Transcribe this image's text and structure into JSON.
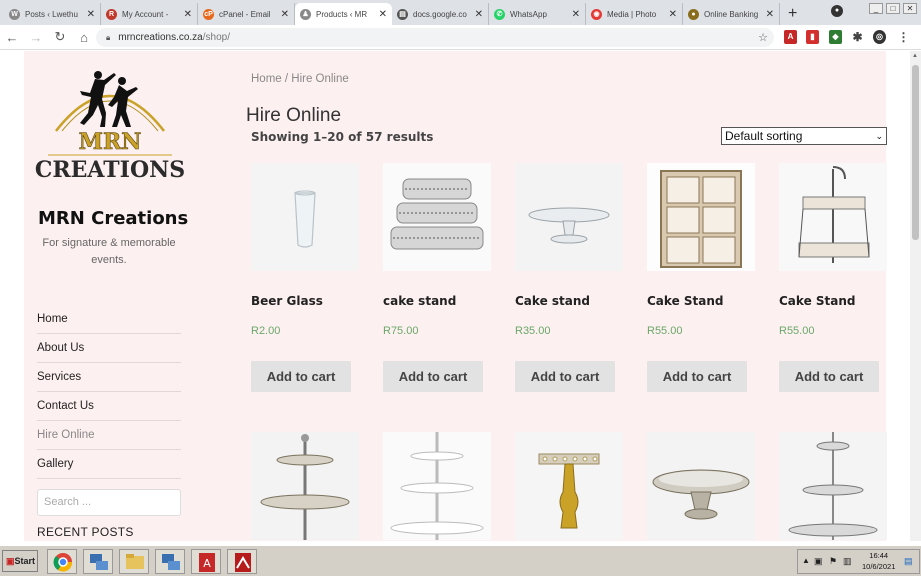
{
  "browser": {
    "tabs": [
      {
        "label": "Posts ‹ Lwethu",
        "icon_color": "#888888",
        "icon_letter": "W",
        "active": false
      },
      {
        "label": "My Account -",
        "icon_color": "#c0392b",
        "icon_letter": "R",
        "active": false
      },
      {
        "label": "cPanel - Email",
        "icon_color": "#e8691d",
        "icon_letter": "cP",
        "active": false
      },
      {
        "label": "Products ‹ MR",
        "icon_color": "#888888",
        "icon_letter": "♟",
        "active": true
      },
      {
        "label": "docs.google.co",
        "icon_color": "#555555",
        "icon_letter": "▤",
        "active": false
      },
      {
        "label": "WhatsApp",
        "icon_color": "#25d366",
        "icon_letter": "✆",
        "active": false
      },
      {
        "label": "Media | Photo",
        "icon_color": "#e53935",
        "icon_letter": "◉",
        "active": false
      },
      {
        "label": "Online Banking",
        "icon_color": "#8a6d1c",
        "icon_letter": "●",
        "active": false
      }
    ],
    "url_domain": "mrncreations.co.za",
    "url_path": "/shop/"
  },
  "site": {
    "logo_text_top": "MRN",
    "logo_text_bottom": "CREATIONS",
    "title": "MRN Creations",
    "tagline": "For signature & memorable events.",
    "menu": [
      "Home",
      "About Us",
      "Services",
      "Contact Us",
      "Hire Online",
      "Gallery"
    ],
    "current_menu": "Hire Online",
    "search_placeholder": "Search ...",
    "recent_posts_heading": "RECENT POSTS"
  },
  "shop": {
    "breadcrumb": "Home / Hire Online",
    "title": "Hire Online",
    "result_count": "Showing 1–20 of 57 results",
    "sorting": "Default sorting",
    "add_to_cart_label": "Add to cart",
    "products": [
      {
        "name": "Beer Glass",
        "price": "R2.00",
        "image": "beer-glass"
      },
      {
        "name": "cake stand",
        "price": "R75.00",
        "image": "mirror-cake-stands"
      },
      {
        "name": "Cake stand",
        "price": "R35.00",
        "image": "glass-cake-stand"
      },
      {
        "name": "Cake Stand",
        "price": "R55.00",
        "image": "wooden-cube-shelf"
      },
      {
        "name": "Cake Stand",
        "price": "R55.00",
        "image": "two-tier-wood-stand"
      }
    ],
    "second_row_images": [
      "ornate-silver-tier-stand",
      "white-tier-stand",
      "gold-jewel-stand",
      "mirror-pedestal-stand",
      "silver-three-tier-stand"
    ]
  },
  "taskbar": {
    "start_label": "Start",
    "time": "16:44",
    "date": "10/6/2021"
  }
}
